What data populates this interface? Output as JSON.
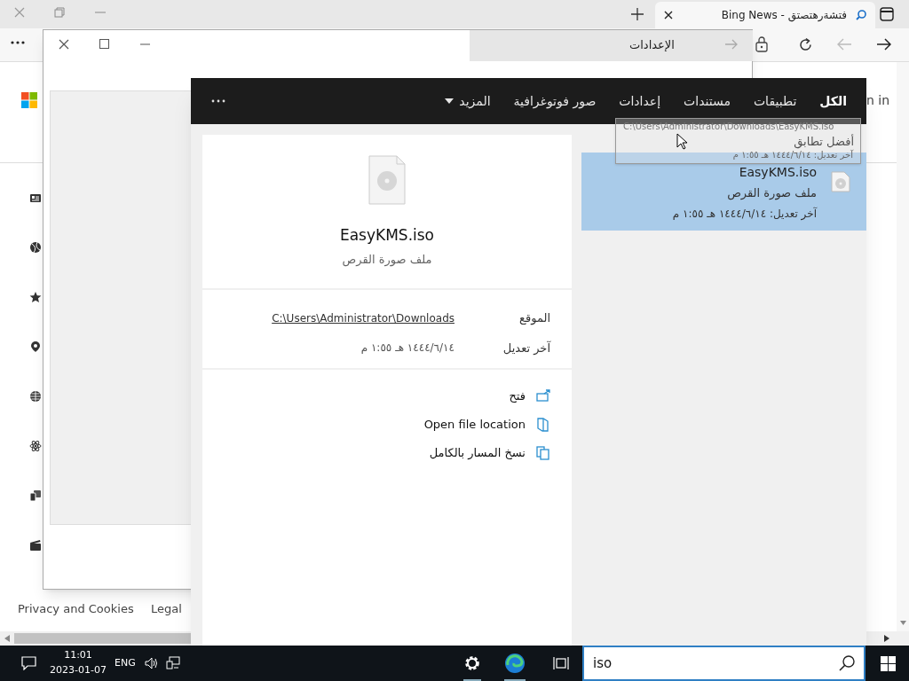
{
  "browser": {
    "tab": {
      "title": "Bing News - فتشةرهتصتق"
    },
    "page": {
      "sign_in": "n in",
      "privacy_link": "Privacy and Cookies",
      "legal_link": "Legal"
    }
  },
  "settings_window": {
    "title": "الإعدادات"
  },
  "search": {
    "tabs": [
      {
        "label": "الكل",
        "selected": true,
        "kind": "tab"
      },
      {
        "label": "تطبيقات",
        "selected": false,
        "kind": "tab"
      },
      {
        "label": "مستندات",
        "selected": false,
        "kind": "tab"
      },
      {
        "label": "إعدادات",
        "selected": false,
        "kind": "tab"
      },
      {
        "label": "صور فوتوغرافية",
        "selected": false,
        "kind": "tab"
      },
      {
        "label": "المزيد",
        "selected": false,
        "kind": "dropdown"
      }
    ],
    "best_match": {
      "heading": "أفضل تطابق",
      "result": {
        "name": "EasyKMS.iso",
        "type": "ملف صورة القرص",
        "modified": "آخر تعديل: ١٤٤٤/٦/١٤ هـ ١:٥٥ م",
        "selected": true
      }
    },
    "tooltip": {
      "lines": [
        "C:\\Users\\Administrator\\Downloads\\EasyKMS.iso",
        "آخر تعديل: ١٤٤٤/٦/١٤ هـ ١:٥٥ م"
      ]
    },
    "preview": {
      "name": "EasyKMS.iso",
      "type": "ملف صورة القرص",
      "details": [
        {
          "label": "الموقع",
          "value": "C:\\Users\\Administrator\\Downloads",
          "kind": "link"
        },
        {
          "label": "آخر تعديل",
          "value": "١٤٤٤/٦/١٤ هـ ١:٥٥ م",
          "kind": "text"
        }
      ],
      "actions": [
        {
          "label": "فتح",
          "kind": "open"
        },
        {
          "label": "Open file location",
          "kind": "folder"
        },
        {
          "label": "نسخ المسار بالكامل",
          "kind": "copy"
        }
      ]
    }
  },
  "taskbar": {
    "search_query": "iso",
    "time": "11:01",
    "date": "2023-01-07",
    "language": "ENG"
  }
}
